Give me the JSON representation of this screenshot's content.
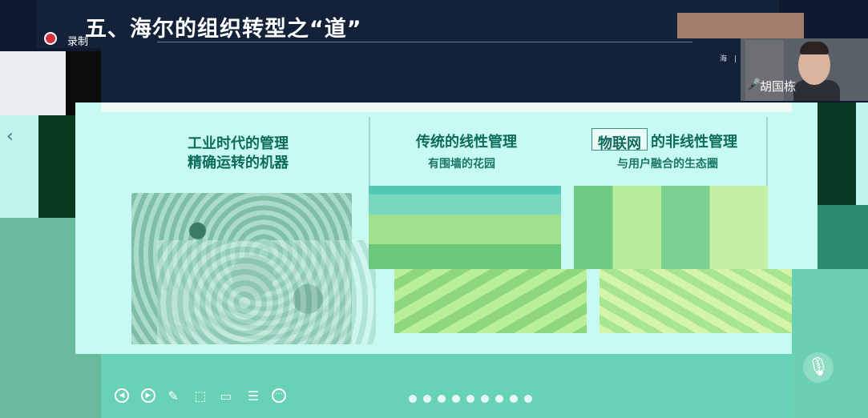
{
  "recording": {
    "label": "录制"
  },
  "slide": {
    "title": "五、海尔的组织转型之“道”",
    "logo_text": "海 | 尔",
    "panels": [
      {
        "title": "工业时代的管理",
        "subtitle": "精确运转的机器"
      },
      {
        "title": "传统的线性管理",
        "subtitle": "有围墙的花园"
      },
      {
        "title_boxed": "物联网",
        "title_rest": "的非线性管理",
        "subtitle": "与用户融合的生态圈"
      }
    ]
  },
  "video": {
    "speaker_name": "胡国栋"
  },
  "toolbar": {
    "icons": [
      "prev-icon",
      "next-icon",
      "pen-icon",
      "selection-icon",
      "video-icon",
      "caption-icon",
      "more-icon"
    ],
    "page_dot_count": 9
  },
  "colors": {
    "slide_bg": "#c7fbf2",
    "title_bar": "#132238",
    "panel_title": "#0d6b5b",
    "toolbar": "#68d2b6",
    "record_red": "#d6323a"
  }
}
